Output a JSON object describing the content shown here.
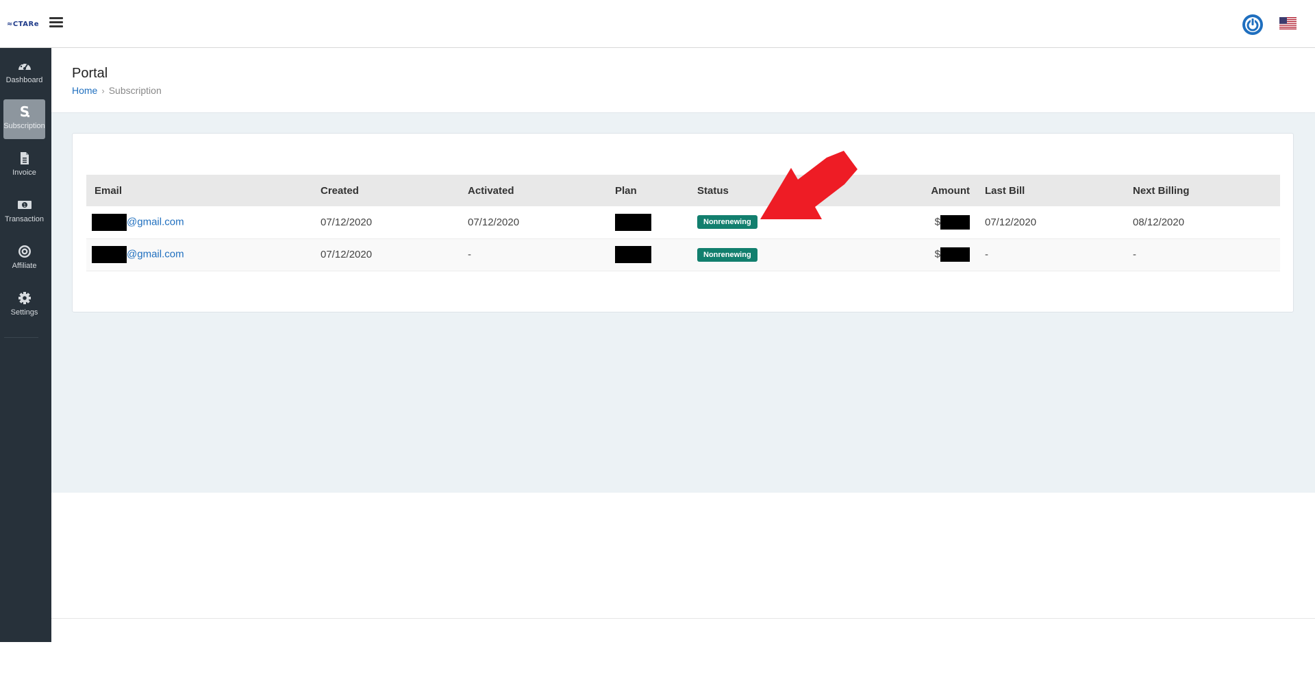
{
  "app": {
    "logo_text": "≈CTARe",
    "accent_color": "#1f6fbf",
    "sidebar_color": "#27313a"
  },
  "sidebar": {
    "items": [
      {
        "label": "Dashboard",
        "icon": "dashboard-icon",
        "active": false
      },
      {
        "label": "Subscription",
        "icon": "dollar-icon",
        "active": true
      },
      {
        "label": "Invoice",
        "icon": "document-icon",
        "active": false
      },
      {
        "label": "Transaction",
        "icon": "money-icon",
        "active": false
      },
      {
        "label": "Affiliate",
        "icon": "bullseye-icon",
        "active": false
      },
      {
        "label": "Settings",
        "icon": "gear-icon",
        "active": false
      }
    ]
  },
  "header": {
    "title": "Portal",
    "breadcrumb": {
      "home": "Home",
      "separator": "›",
      "current": "Subscription"
    }
  },
  "table": {
    "columns": [
      "Email",
      "Created",
      "Activated",
      "Plan",
      "Status",
      "Amount",
      "Last Bill",
      "Next Billing"
    ],
    "rows": [
      {
        "email": "@gmail.com",
        "created": "07/12/2020",
        "activated": "07/12/2020",
        "status": "Nonrenewing",
        "amount_prefix": "$",
        "last_bill": "07/12/2020",
        "next_billing": "08/12/2020"
      },
      {
        "email": "@gmail.com",
        "created": "07/12/2020",
        "activated": "-",
        "status": "Nonrenewing",
        "amount_prefix": "$",
        "last_bill": "-",
        "next_billing": "-"
      }
    ],
    "status_color": "#127f6e"
  },
  "annotation": {
    "arrow_color": "#ee1c25"
  }
}
